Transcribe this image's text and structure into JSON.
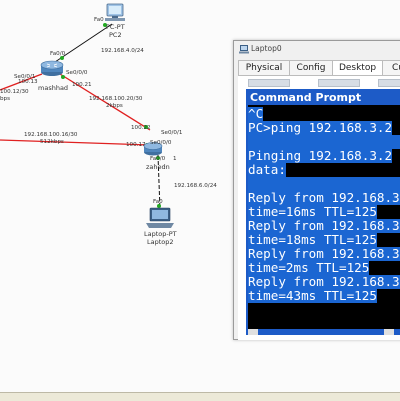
{
  "network": {
    "devices": [
      {
        "id": "pc2",
        "type_label": "PC-PT",
        "name": "PC2",
        "port_label": "Fa0"
      },
      {
        "id": "mashhad",
        "name": "mashhad"
      },
      {
        "id": "zahedn",
        "name": "zahedn"
      },
      {
        "id": "laptop2",
        "type_label": "Laptop-PT",
        "name": "Laptop2",
        "port_label": "Fa0"
      }
    ],
    "labels": {
      "pc2_fa0": "Fa0",
      "mashhad_fa00": "Fa0/0",
      "mashhad_se01": "Se0/0/1",
      "mashhad_se00": "Se0/0/0",
      "net_192_168_4": "192.168.4.0/24",
      "ip_100_13": "100.13",
      "net_100_12": "100.12/30",
      "bw_left": "bps",
      "ip_100_21": "100.21",
      "net_100_20": "192.168.100.20/30",
      "bw_20": "2kbps",
      "zahedn_ip_22": "100.22",
      "zahedn_se01": "Se0/0/1",
      "zahedn_se00": "Se0/0/0",
      "zahedn_ip_17": "100.17",
      "net_100_16": "192.168.100.16/30",
      "bw_16": "512kbps",
      "zahedn_fa01": "Fa0/0",
      "zahedn_num": "1",
      "net_192_168_6": "192.168.6.0/24",
      "laptop_fa0": "Fa0"
    }
  },
  "window": {
    "title": "Laptop0",
    "tabs": [
      "Physical",
      "Config",
      "Desktop",
      "Cu"
    ],
    "active_tab": "Desktop",
    "command_prompt": {
      "title": "Command Prompt",
      "lines": [
        "^C",
        "PC>ping 192.168.3.2",
        "",
        "Pinging 192.168.3.2",
        "data:",
        "",
        "Reply from 192.168.3",
        "time=16ms TTL=125",
        "Reply from 192.168.3",
        "time=18ms TTL=125",
        "Reply from 192.168.3",
        "time=2ms TTL=125",
        "Reply from 192.168.3",
        "time=43ms TTL=125"
      ]
    }
  },
  "colors": {
    "serial_link": "#e02020",
    "ethernet_link": "#111111",
    "link_up": "#22aa22",
    "cmd_frame": "#1d5bc7",
    "cmd_highlight": "#1b66d2"
  }
}
